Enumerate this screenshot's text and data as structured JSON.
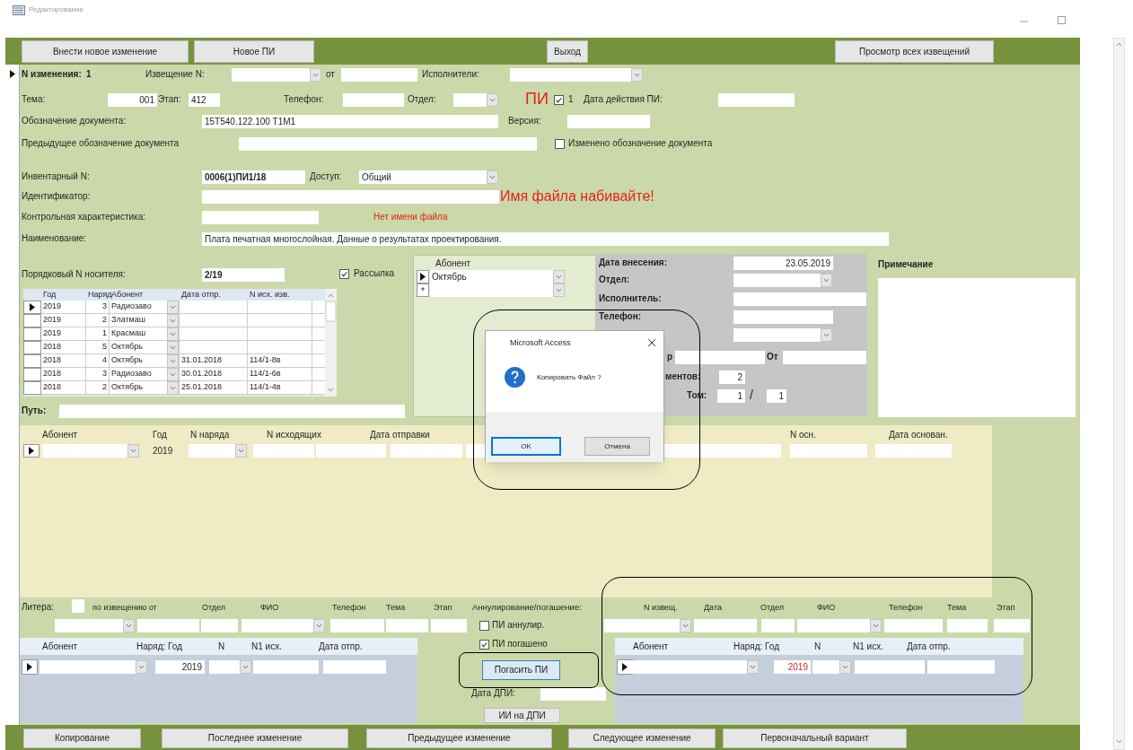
{
  "window": {
    "title": "Редактирование"
  },
  "toolbar": [
    "Внести новое изменение",
    "Новое ПИ",
    "Выход",
    "Просмотр всех извещений"
  ],
  "form": {
    "change_label": "N изменения:",
    "change_number": "1",
    "notice_label": "Извещение N:",
    "from_label": "от",
    "executors_label": "Исполнители:",
    "theme_label": "Тема:",
    "theme_value": "001",
    "stage_label": "Этап:",
    "stage_value": "412",
    "phone_label": "Телефон:",
    "dept_label": "Отдел:",
    "pi_label": "ПИ",
    "pi_checked": true,
    "pi_count": "1",
    "pi_date_label": "Дата действия ПИ:",
    "designation_label": "Обозначение документа:",
    "designation_value": "15Т540.122.100 Т1М1",
    "version_label": "Версия:",
    "prev_designation_label": "Предыдущее обозначение документа",
    "designation_changed_label": "Изменено обозначение документа",
    "designation_changed": false,
    "inventory_label": "Инвентарный N:",
    "inventory_value": "0006(1)ПИ1/18",
    "access_label": "Доступ:",
    "access_value": "Общий",
    "identifier_label": "Идентификатор:",
    "file_name_warning": "Имя файла набивайте!",
    "checksum_label": "Контрольная характеристика:",
    "no_file_name": "Нет имени файла",
    "name_label": "Наименование:",
    "name_value": "Плата печатная многослойная. Данные о результатах проектирования.",
    "carrier_label": "Порядковый N носителя:",
    "carrier_value": "2/19",
    "mailing_label": "Рассылка",
    "mailing": true,
    "path_label": "Путь:"
  },
  "carrier_grid": {
    "columns": [
      "Год",
      "Наряд",
      "Абонент",
      "Дата отпр.",
      "N исх. изв."
    ],
    "rows": [
      {
        "year": "2019",
        "order": "3",
        "subscriber": "Радиозаво",
        "selected": true
      },
      {
        "year": "2019",
        "order": "2",
        "subscriber": "Златмаш",
        "selected": false
      },
      {
        "year": "2019",
        "order": "1",
        "subscriber": "Красмаш",
        "selected": false
      },
      {
        "year": "2018",
        "order": "5",
        "subscriber": "Октябрь",
        "selected": false
      },
      {
        "year": "2018",
        "order": "4",
        "subscriber": "Октябрь",
        "date": "31.01.2018",
        "outgoing": "114/1-8в",
        "selected": false
      },
      {
        "year": "2018",
        "order": "3",
        "subscriber": "Радиозаво",
        "date": "30.01.2018",
        "outgoing": "114/1-6в",
        "selected": false
      },
      {
        "year": "2018",
        "order": "2",
        "subscriber": "Октябрь",
        "date": "25.01.2018",
        "outgoing": "114/1-4в",
        "selected": false
      }
    ]
  },
  "subscribers": {
    "header": "Абонент",
    "rows": [
      {
        "name": "Октябрь",
        "selected": true
      }
    ],
    "new_row_mark": "*"
  },
  "registration": {
    "date_label": "Дата внесения:",
    "date_value": "23.05.2019",
    "dept_label": "Отдел:",
    "executor_label": "Исполнитель:",
    "phone_label": "Телефон:",
    "number_label_fragment": "р",
    "from_label": "От",
    "docs_label_fragment": "ментов:",
    "docs_count": "2",
    "volume_label": "Том:",
    "volume": "1",
    "volume_sep": "/",
    "volumes": "1"
  },
  "note_label": "Примечание",
  "dispatch": {
    "columns": [
      "Абонент",
      "Год",
      "N наряда",
      "N исходящих",
      "Дата отправки",
      "N осн.",
      "Дата основан."
    ],
    "year": "2019"
  },
  "cancellation": {
    "litera_label": "Литера:",
    "labels": [
      "по извещению от",
      "Отдел",
      "ФИО",
      "Телефон",
      "Тема",
      "Этап"
    ],
    "title": "Аннулирование/погашение:",
    "checks": [
      {
        "label": "ПИ аннулир.",
        "checked": false
      },
      {
        "label": "ПИ погашено",
        "checked": true
      }
    ],
    "repay_button": "Погасить ПИ",
    "dpi_date_label": "Дата ДПИ:",
    "ii_button": "ИИ на ДПИ"
  },
  "left_grid": {
    "columns": [
      "Абонент",
      "Наряд: Год",
      "N",
      "N1 исх.",
      "Дата отпр."
    ],
    "year": "2019"
  },
  "repayment": {
    "labels": [
      "N извещ.",
      "Дата",
      "Отдел",
      "ФИО",
      "Телефон",
      "Тема",
      "Этап"
    ]
  },
  "right_grid": {
    "columns": [
      "Абонент",
      "Наряд: Год",
      "N",
      "N1 исх.",
      "Дата  отпр."
    ],
    "year": "2019"
  },
  "footer": [
    "Копирование",
    "Последнее изменение",
    "Предыдущее изменение",
    "Следующее изменение",
    "Первоначальный вариант"
  ],
  "dialog": {
    "title": "Microsoft Access",
    "message": "Копировать Файл ?",
    "buttons": [
      {
        "label": "OK",
        "selected": true
      },
      {
        "label": "Отмена",
        "selected": false
      }
    ]
  }
}
